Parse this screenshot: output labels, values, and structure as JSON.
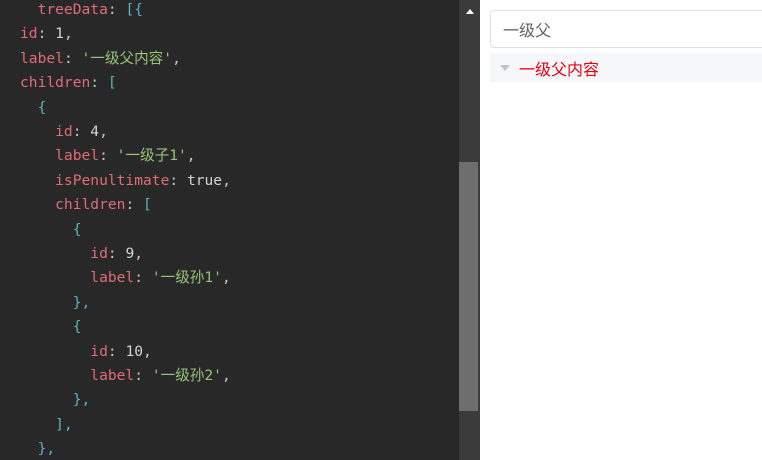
{
  "code": {
    "lines": [
      [
        {
          "t": "  treeData",
          "c": "k"
        },
        {
          "t": ": ",
          "c": "p"
        },
        {
          "t": "[{",
          "c": "b"
        }
      ],
      [
        {
          "t": "id",
          "c": "k"
        },
        {
          "t": ": ",
          "c": "p"
        },
        {
          "t": "1",
          "c": "n"
        },
        {
          "t": ",",
          "c": "p"
        }
      ],
      [
        {
          "t": "label",
          "c": "k"
        },
        {
          "t": ": ",
          "c": "p"
        },
        {
          "t": "'一级父内容'",
          "c": "s"
        },
        {
          "t": ",",
          "c": "p"
        }
      ],
      [
        {
          "t": "children",
          "c": "k"
        },
        {
          "t": ": ",
          "c": "p"
        },
        {
          "t": "[",
          "c": "b"
        }
      ],
      [
        {
          "t": "  {",
          "c": "b"
        }
      ],
      [
        {
          "t": "    id",
          "c": "k"
        },
        {
          "t": ": ",
          "c": "p"
        },
        {
          "t": "4",
          "c": "n"
        },
        {
          "t": ",",
          "c": "p"
        }
      ],
      [
        {
          "t": "    label",
          "c": "k"
        },
        {
          "t": ": ",
          "c": "p"
        },
        {
          "t": "'一级子1'",
          "c": "s"
        },
        {
          "t": ",",
          "c": "p"
        }
      ],
      [
        {
          "t": "    isPenultimate",
          "c": "k"
        },
        {
          "t": ": ",
          "c": "p"
        },
        {
          "t": "true",
          "c": "n"
        },
        {
          "t": ",",
          "c": "p"
        }
      ],
      [
        {
          "t": "    children",
          "c": "k"
        },
        {
          "t": ": ",
          "c": "p"
        },
        {
          "t": "[",
          "c": "b"
        }
      ],
      [
        {
          "t": "      {",
          "c": "b"
        }
      ],
      [
        {
          "t": "        id",
          "c": "k"
        },
        {
          "t": ": ",
          "c": "p"
        },
        {
          "t": "9",
          "c": "n"
        },
        {
          "t": ",",
          "c": "p"
        }
      ],
      [
        {
          "t": "        label",
          "c": "k"
        },
        {
          "t": ": ",
          "c": "p"
        },
        {
          "t": "'一级孙1'",
          "c": "s"
        },
        {
          "t": ",",
          "c": "p"
        }
      ],
      [
        {
          "t": "      },",
          "c": "b"
        }
      ],
      [
        {
          "t": "      {",
          "c": "b"
        }
      ],
      [
        {
          "t": "        id",
          "c": "k"
        },
        {
          "t": ": ",
          "c": "p"
        },
        {
          "t": "10",
          "c": "n"
        },
        {
          "t": ",",
          "c": "p"
        }
      ],
      [
        {
          "t": "        label",
          "c": "k"
        },
        {
          "t": ": ",
          "c": "p"
        },
        {
          "t": "'一级孙2'",
          "c": "s"
        },
        {
          "t": ",",
          "c": "p"
        }
      ],
      [
        {
          "t": "      },",
          "c": "b"
        }
      ],
      [
        {
          "t": "    ],",
          "c": "b"
        }
      ],
      [
        {
          "t": "  },",
          "c": "b"
        }
      ]
    ]
  },
  "colors": {
    "editor_bg": "#282828",
    "key": "#e06c75",
    "string": "#98c379",
    "bracket": "#56b6c2",
    "node_label": "#e60012"
  },
  "search": {
    "value": "一级父"
  },
  "tree": {
    "nodes": [
      {
        "label": "一级父内容",
        "expanded": true
      }
    ]
  },
  "icons": {
    "scroll_up": "triangle-up-icon",
    "caret": "caret-down-icon"
  }
}
